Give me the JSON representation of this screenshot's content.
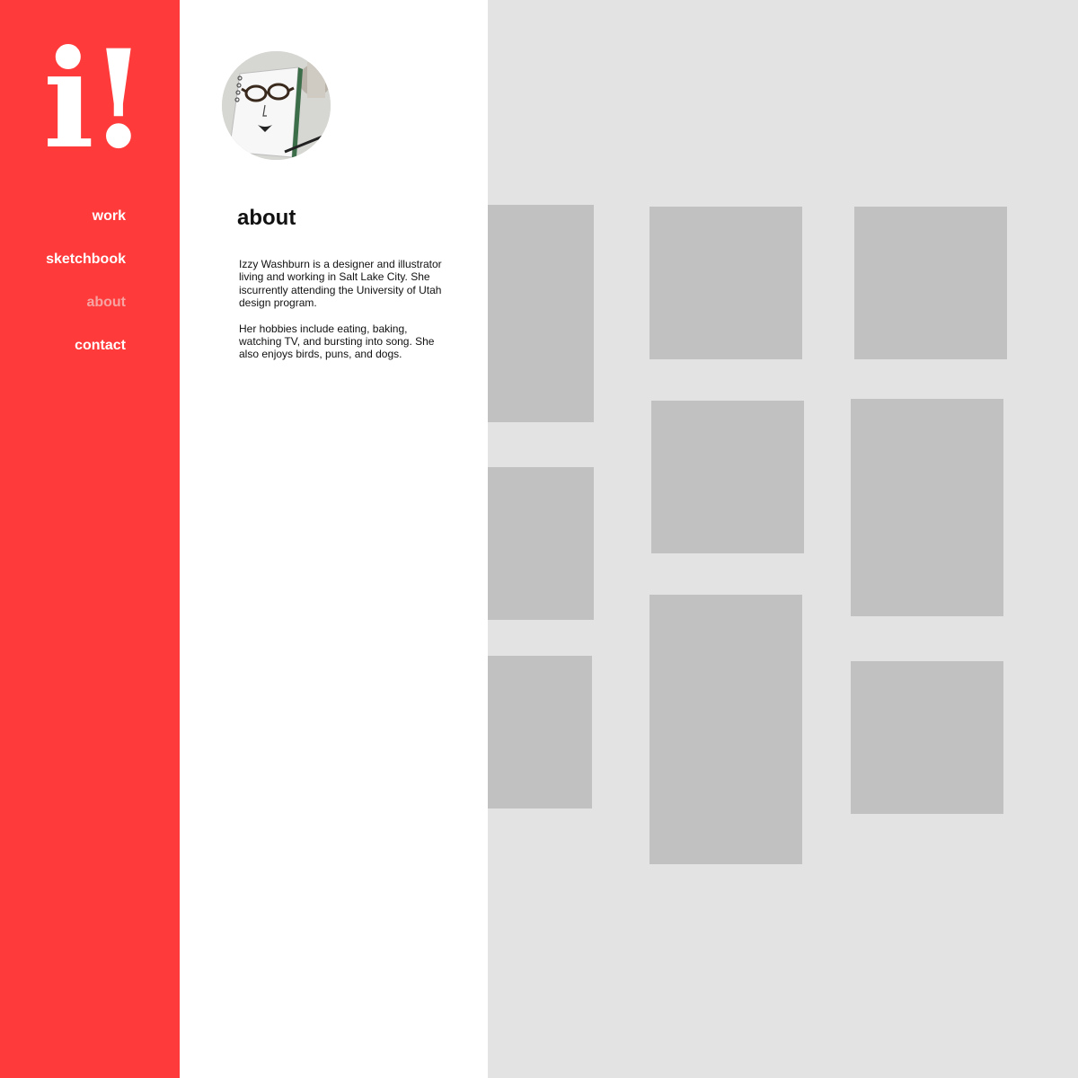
{
  "logo": {
    "text": "i!"
  },
  "nav": {
    "items": [
      {
        "label": "work",
        "active": false
      },
      {
        "label": "sketchbook",
        "active": false
      },
      {
        "label": "about",
        "active": true
      },
      {
        "label": "contact",
        "active": false
      }
    ]
  },
  "about": {
    "title": "about",
    "paragraphs": [
      "Izzy Washburn is a designer and illustrator living and working in Salt Lake City. She iscurrently attending the University of Utah design program.",
      "Her hobbies include eating, baking, watching TV, and bursting into song. She also enjoys birds, puns, and dogs."
    ]
  },
  "colors": {
    "accent": "#fe3b3a",
    "nav_active": "#f6a3a2",
    "gallery_bg": "#e3e3e3",
    "tile": "#c1c1c1"
  }
}
